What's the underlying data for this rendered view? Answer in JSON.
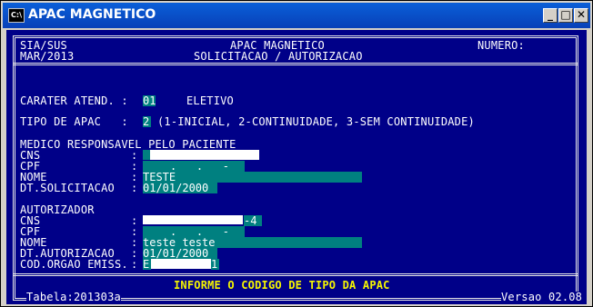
{
  "window": {
    "icon_text": "C:\\",
    "title": "APAC MAGNETICO",
    "btn_min": "_",
    "btn_max": "□",
    "btn_close": "✕"
  },
  "header": {
    "left1": "SIA/SUS",
    "left2": "MAR/2013",
    "center1": "APAC MAGNETICO",
    "center2": "SOLICITACAO / AUTORIZACAO",
    "numero_label": "NUMERO:"
  },
  "form": {
    "carater_label": "CARATER ATEND. :",
    "carater_value": "01",
    "carater_desc": "ELETIVO",
    "tipo_label": "TIPO DE APAC   :",
    "tipo_value": "2",
    "tipo_desc": "(1-INICIAL, 2-CONTINUIDADE, 3-SEM CONTINUIDADE)",
    "medico_section": "MEDICO RESPONSAVEL PELO PACIENTE",
    "cns_label": "CNS",
    "cpf_label": "CPF",
    "nome_label": "NOME",
    "dtsol_label": "DT.SOLICITACAO",
    "medico_cpf_mask": ".   .   -",
    "medico_nome": "TESTE",
    "medico_dt": "01/01/2000",
    "autorizador_section": "AUTORIZADOR",
    "aut_cns_suffix": "-4",
    "aut_cpf_mask": ".   .   -",
    "aut_nome": "teste teste",
    "dtaut_label": "DT.AUTORIZACAO",
    "aut_dt": "01/01/2000",
    "orgao_label": "COD.ORGAO EMISS.",
    "orgao_prefix": "E",
    "orgao_suffix": "1",
    "colon": ":"
  },
  "footer": {
    "message": "INFORME O CODIGO DE TIPO DA APAC",
    "tabela": "Tabela:201303a",
    "versao": "Versao 02.08"
  },
  "colors": {
    "console_bg": "#000088",
    "field_bg": "#008080",
    "highlight": "#f5f500"
  }
}
